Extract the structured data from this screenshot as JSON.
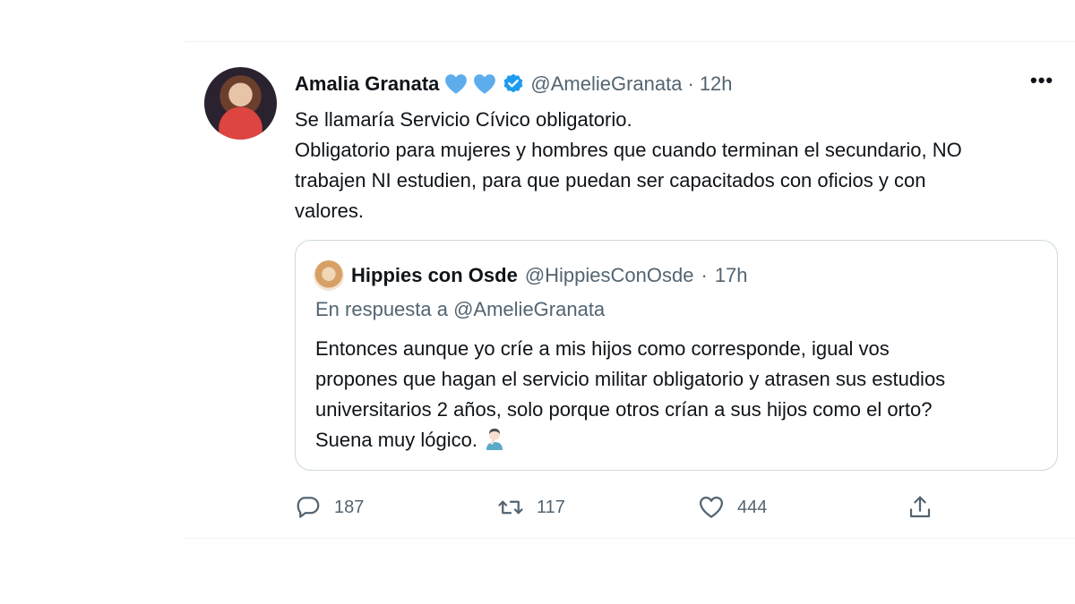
{
  "tweet": {
    "author_name": "Amalia Granata",
    "handle": "@AmelieGranata",
    "separator": "·",
    "time": "12h",
    "more_label": "•••",
    "lines": [
      "Se llamaría Servicio Cívico obligatorio.",
      "Obligatorio para mujeres y hombres que cuando terminan el secundario, NO",
      "trabajen NI estudien, para que puedan ser capacitados con oficios y con",
      "valores."
    ],
    "icons": {
      "heart": "blue-heart-icon",
      "verified": "verified-badge-icon"
    },
    "accent_color": "#1d9bf0"
  },
  "quote": {
    "author_name": "Hippies con Osde",
    "handle": "@HippiesConOsde",
    "separator": "·",
    "time": "17h",
    "reply_to": "En respuesta a @AmelieGranata",
    "lines": [
      "Entonces aunque yo críe a mis hijos como corresponde, igual vos",
      "propones que hagan el servicio militar obligatorio y atrasen sus estudios",
      "universitarios 2 años, solo porque otros crían a sus hijos como el orto?",
      "Suena muy lógico."
    ],
    "emoji": "man-facepalming-emoji"
  },
  "actions": {
    "replies": "187",
    "retweets": "117",
    "likes": "444"
  }
}
